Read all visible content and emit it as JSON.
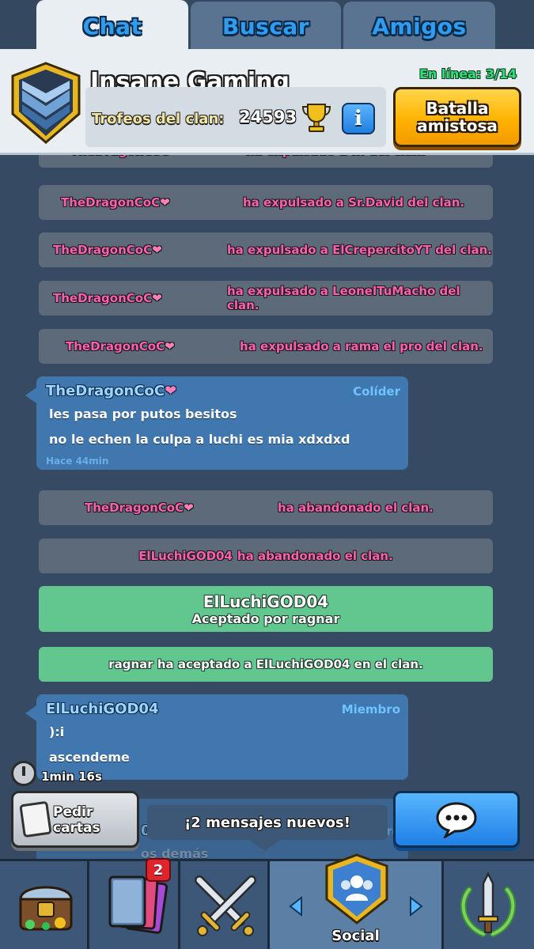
{
  "tabs": [
    {
      "label": "Chat",
      "active": true
    },
    {
      "label": "Buscar",
      "active": false
    },
    {
      "label": "Amigos",
      "active": false
    }
  ],
  "clan": {
    "name": "Insane Gaming",
    "trophies_label": "Trofeos del clan:",
    "trophies": "24593",
    "online": "En línea: 3/14",
    "battle_button": "Batalla amistosa",
    "info_label": "i"
  },
  "feed": {
    "partial_top": {
      "who": "TheDragonCoC",
      "what": "ha expulsado a ... del clan."
    },
    "system_kicks": [
      {
        "who": "TheDragonCoC",
        "what": "ha expulsado a Sr.David del clan."
      },
      {
        "who": "TheDragonCoC",
        "what": "ha expulsado a ElCrepercitoYT del clan."
      },
      {
        "who": "TheDragonCoC",
        "what": "ha expulsado a LeonelTuMacho del clan."
      },
      {
        "who": "TheDragonCoC",
        "what": "ha expulsado a rama el pro del clan."
      }
    ],
    "message1": {
      "name": "TheDragonCoC",
      "role": "Colíder",
      "lines": [
        "les pasa por putos besitos",
        "no le echen la culpa a luchi es mia xdxdxd"
      ],
      "time": "Hace 44min"
    },
    "left1": {
      "who": "TheDragonCoC",
      "what": "ha abandonado el clan."
    },
    "left2": {
      "text": "ElLuchiGOD04 ha abandonado el clan.",
      "who": "ElLuchiGOD04",
      "what": "ha abandonado el clan."
    },
    "accepted": {
      "name": "ElLuchiGOD04",
      "by": "Aceptado por ragnar"
    },
    "accepted_sys": {
      "text": "ragnar ha aceptado a ElLuchiGOD04 en el clan."
    },
    "message2": {
      "name": "ElLuchiGOD04",
      "role": "Miembro",
      "lines": [
        "):i",
        "ascendeme"
      ]
    },
    "hidden_partial": {
      "prefix": "04",
      "suffix": "mbro",
      "line": "os demás"
    }
  },
  "bottom": {
    "timer": "1min 16s",
    "request_cards": "Pedir cartas",
    "new_messages": "¡2 mensajes nuevos!"
  },
  "nav": {
    "items": [
      "shop",
      "cards",
      "battle",
      "social",
      "tournaments"
    ],
    "social_label": "Social",
    "cards_badge": "2"
  },
  "colors": {
    "background": "#364a63",
    "system_pink": "#ff5fb0",
    "bubble_blue": "#3f77ae",
    "accept_green": "#62c78f",
    "battle_yellow": "#ffb300",
    "online_green": "#2ee07a"
  }
}
